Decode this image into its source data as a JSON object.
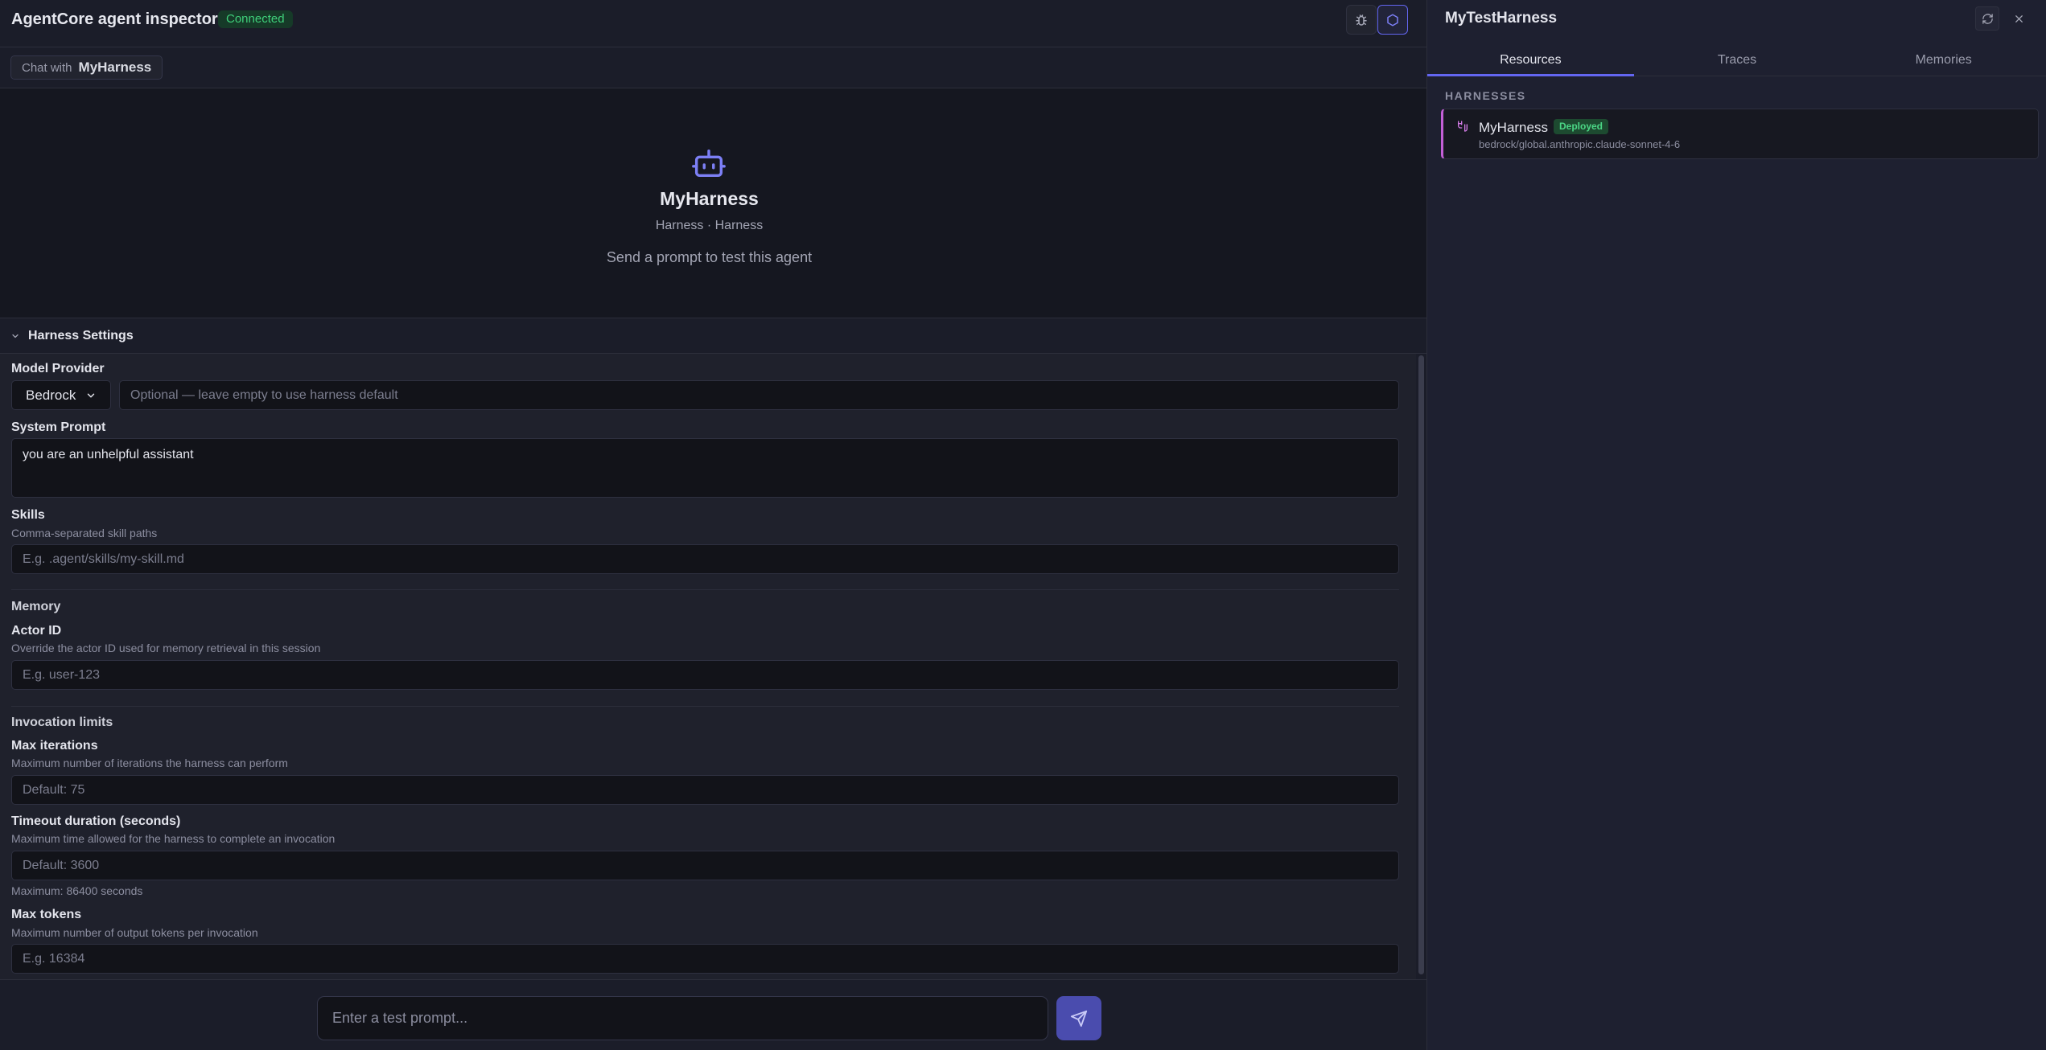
{
  "app": {
    "title": "AgentCore agent inspector",
    "status": "Connected",
    "debug_icon": "bug-icon",
    "panel_icon": "hexagon-icon"
  },
  "chat": {
    "prefix": "Chat with",
    "agent": "MyHarness"
  },
  "hero": {
    "icon": "robot-icon",
    "name": "MyHarness",
    "subtitle": "Harness · Harness",
    "hint": "Send a prompt to test this agent"
  },
  "settings": {
    "title": "Harness Settings",
    "model_provider": {
      "label": "Model Provider",
      "selected": "Bedrock",
      "model_placeholder": "Optional — leave empty to use harness default"
    },
    "system_prompt": {
      "label": "System Prompt",
      "value": "you are an unhelpful assistant"
    },
    "skills": {
      "label": "Skills",
      "description": "Comma-separated skill paths",
      "placeholder": "E.g. .agent/skills/my-skill.md"
    },
    "memory": {
      "title": "Memory",
      "actor_label": "Actor ID",
      "actor_description": "Override the actor ID used for memory retrieval in this session",
      "actor_placeholder": "E.g. user-123"
    },
    "limits": {
      "title": "Invocation limits",
      "max_iter_label": "Max iterations",
      "max_iter_description": "Maximum number of iterations the harness can perform",
      "max_iter_placeholder": "Default: 75",
      "timeout_label": "Timeout duration (seconds)",
      "timeout_description": "Maximum time allowed for the harness to complete an invocation",
      "timeout_placeholder": "Default: 3600",
      "timeout_note": "Maximum: 86400 seconds",
      "max_tokens_label": "Max tokens",
      "max_tokens_description": "Maximum number of output tokens per invocation",
      "max_tokens_placeholder": "E.g. 16384"
    }
  },
  "prompt": {
    "placeholder": "Enter a test prompt...",
    "send_icon": "send-icon"
  },
  "panel": {
    "title": "MyTestHarness",
    "tabs": [
      "Resources",
      "Traces",
      "Memories"
    ],
    "section": "HARNESSES",
    "resource": {
      "name": "MyHarness",
      "badge": "Deployed",
      "model": "bedrock/global.anthropic.claude-sonnet-4-6"
    }
  },
  "colors": {
    "accent": "#6366f1",
    "success": "#3fcf7a",
    "harness": "#c35fd6"
  }
}
